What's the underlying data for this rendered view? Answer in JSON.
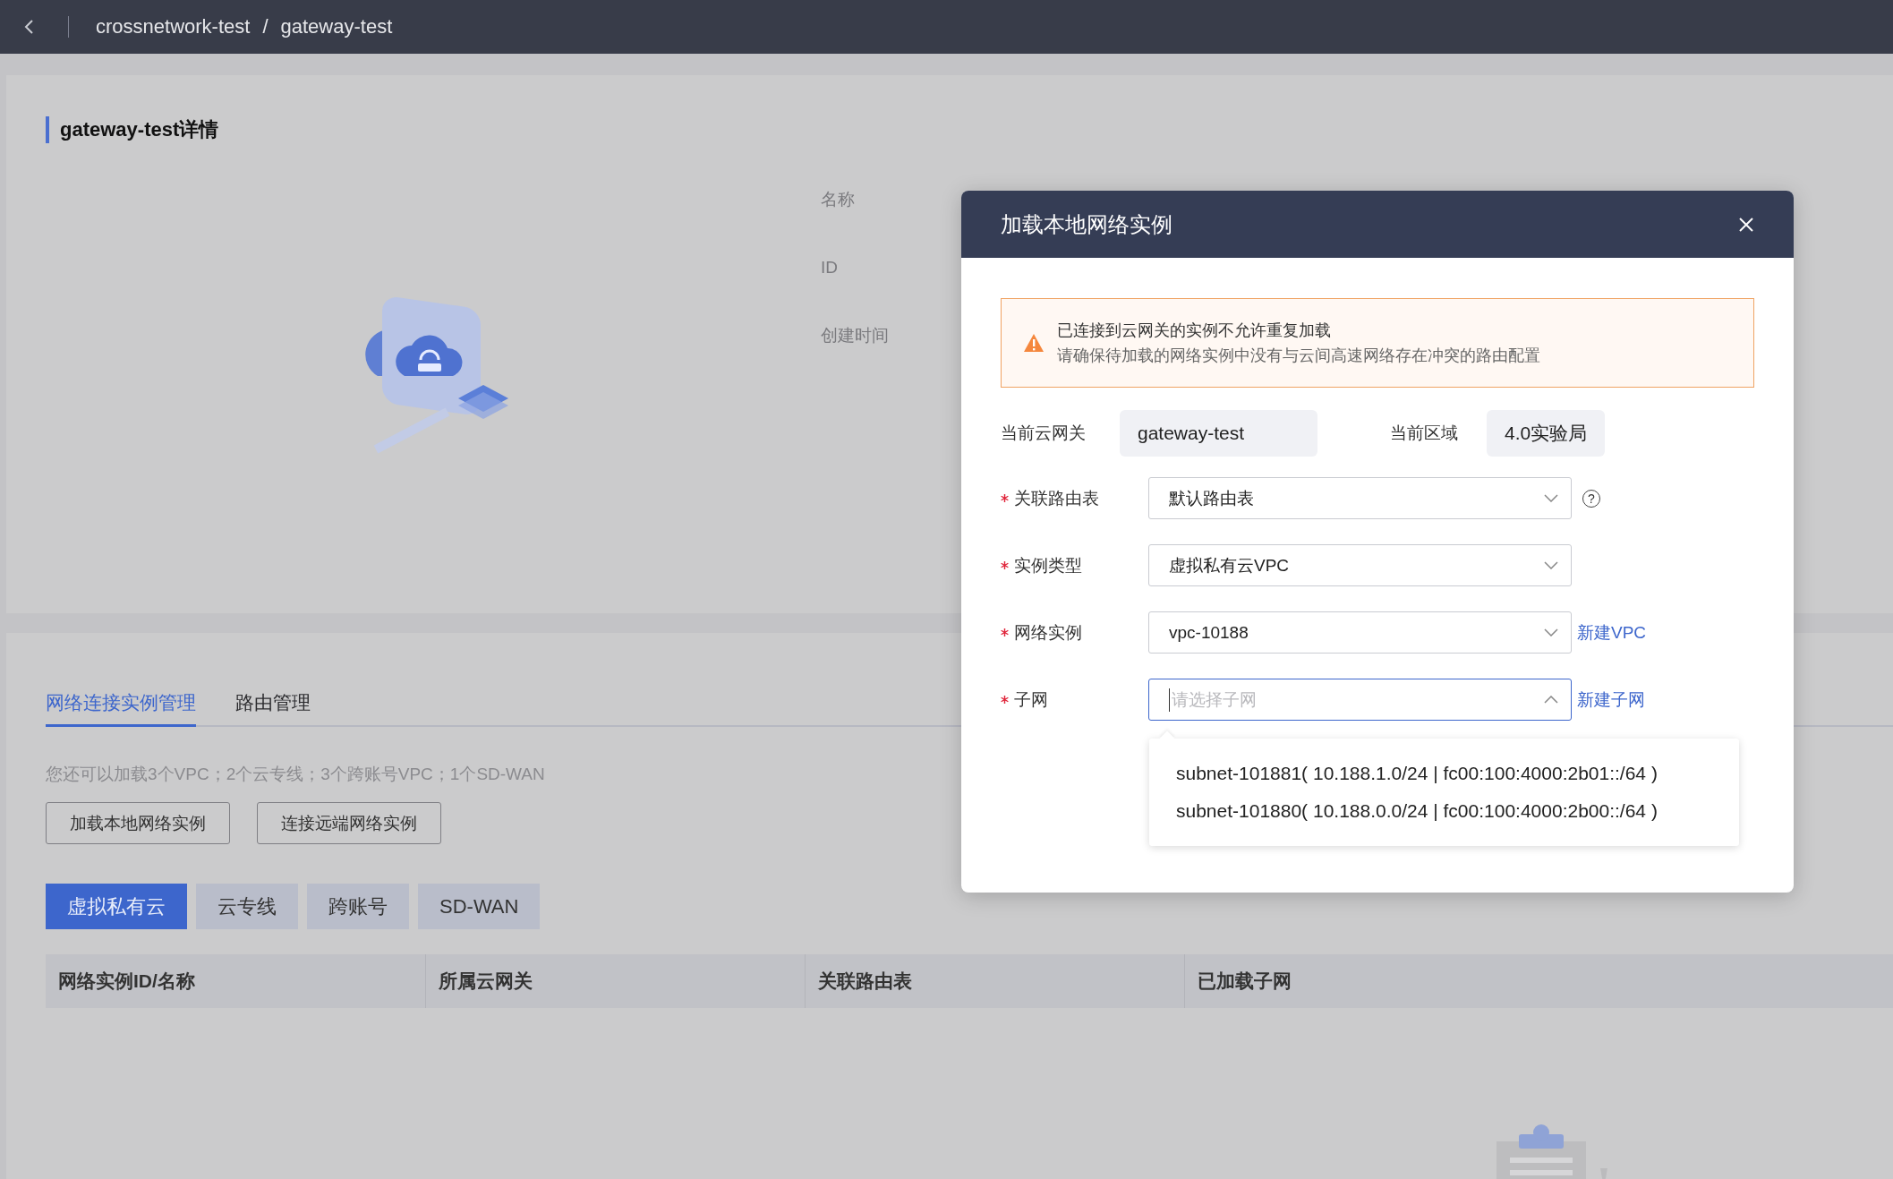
{
  "breadcrumb": {
    "items": [
      "crossnetwork-test",
      "gateway-test"
    ],
    "separator": "/"
  },
  "detail": {
    "title": "gateway-test详情",
    "fields": [
      {
        "label": "名称"
      },
      {
        "label": "ID"
      },
      {
        "label": "创建时间"
      }
    ]
  },
  "tabs": [
    {
      "label": "网络连接实例管理",
      "selected": true
    },
    {
      "label": "路由管理",
      "selected": false
    }
  ],
  "quota_text": "您还可以加载3个VPC；2个云专线；3个跨账号VPC；1个SD-WAN",
  "action_buttons": [
    "加载本地网络实例",
    "连接远端网络实例"
  ],
  "type_tabs": [
    {
      "label": "虚拟私有云",
      "selected": true
    },
    {
      "label": "云专线",
      "selected": false
    },
    {
      "label": "跨账号",
      "selected": false
    },
    {
      "label": "SD-WAN",
      "selected": false
    }
  ],
  "table": {
    "columns": [
      "网络实例ID/名称",
      "所属云网关",
      "关联路由表",
      "已加载子网"
    ]
  },
  "dialog": {
    "title": "加载本地网络实例",
    "alert": {
      "lines": [
        "已连接到云网关的实例不允许重复加载",
        "请确保待加载的网络实例中没有与云间高速网络存在冲突的路由配置"
      ]
    },
    "info": [
      {
        "label": "当前云网关",
        "value": "gateway-test"
      },
      {
        "label": "当前区域",
        "value": "4.0实验局"
      }
    ],
    "fields": [
      {
        "label": "关联路由表",
        "required": true,
        "value": "默认路由表",
        "expanded": false,
        "help": "?"
      },
      {
        "label": "实例类型",
        "required": true,
        "value": "虚拟私有云VPC",
        "expanded": false
      },
      {
        "label": "网络实例",
        "required": true,
        "value": "vpc-10188",
        "expanded": false,
        "link": "新建VPC"
      },
      {
        "label": "子网",
        "required": true,
        "placeholder": "请选择子网",
        "expanded": true,
        "link": "新建子网"
      }
    ],
    "options": [
      "subnet-101881( 10.188.1.0/24 | fc00:100:4000:2b01::/64 )",
      "subnet-101880( 10.188.0.0/24 | fc00:100:4000:2b00::/64 )"
    ]
  }
}
